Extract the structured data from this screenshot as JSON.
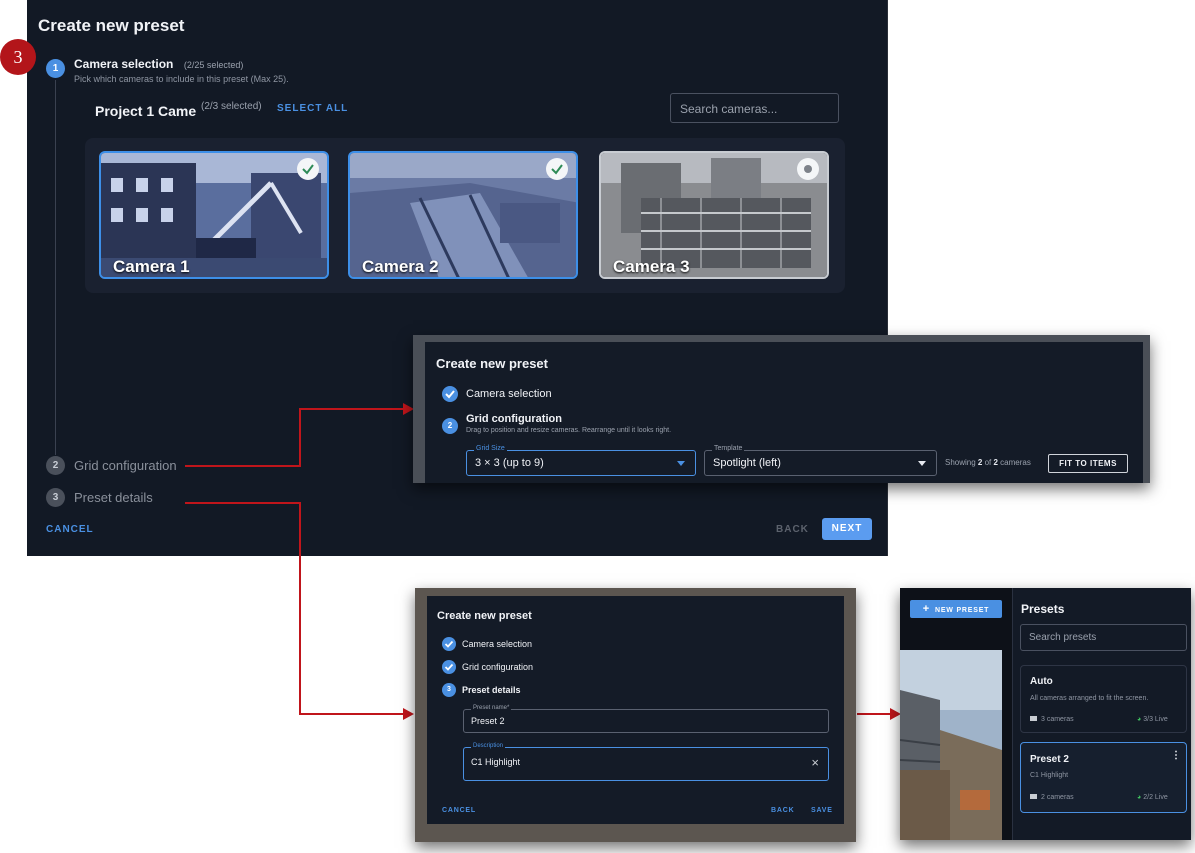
{
  "callout_number": "3",
  "main": {
    "title": "Create new preset",
    "steps": [
      {
        "number": "1",
        "title": "Camera selection",
        "count": "(2/25 selected)",
        "subtitle": "Pick which cameras to include in this preset (Max 25)."
      },
      {
        "number": "2",
        "title": "Grid configuration"
      },
      {
        "number": "3",
        "title": "Preset details"
      }
    ],
    "project": {
      "name": "Project 1 Came",
      "count": "(2/3 selected)",
      "select_all": "SELECT ALL"
    },
    "search_placeholder": "Search cameras...",
    "cameras": [
      {
        "label": "Camera 1",
        "selected": true
      },
      {
        "label": "Camera 2",
        "selected": true
      },
      {
        "label": "Camera 3",
        "selected": false
      }
    ],
    "cancel": "CANCEL",
    "back": "BACK",
    "next": "NEXT"
  },
  "inset_grid": {
    "title": "Create new preset",
    "step1": "Camera selection",
    "step2_number": "2",
    "step2": "Grid configuration",
    "step2_sub": "Drag to position and resize cameras. Rearrange until it looks right.",
    "grid_size_label": "Grid Size",
    "grid_size_value": "3 × 3 (up to 9)",
    "template_label": "Template",
    "template_value": "Spotlight (left)",
    "showing_prefix": "Showing ",
    "showing_a": "2",
    "showing_of": " of ",
    "showing_b": "2",
    "showing_suffix": " cameras",
    "fit_button": "FIT TO ITEMS"
  },
  "inset_details": {
    "title": "Create new preset",
    "step1": "Camera selection",
    "step2": "Grid configuration",
    "step3_number": "3",
    "step3": "Preset details",
    "name_label": "Preset name*",
    "name_value": "Preset 2",
    "desc_label": "Description",
    "desc_value": "C1 Highlight",
    "cancel": "CANCEL",
    "back": "BACK",
    "save": "SAVE"
  },
  "inset_presets": {
    "new_preset": "NEW PRESET",
    "heading": "Presets",
    "search_placeholder": "Search presets",
    "presets": [
      {
        "name": "Auto",
        "description": "All cameras arranged to fit the screen.",
        "cameras": "3 cameras",
        "live": "3/3 Live"
      },
      {
        "name": "Preset 2",
        "description": "C1 Highlight",
        "cameras": "2 cameras",
        "live": "2/2 Live"
      }
    ]
  },
  "colors": {
    "accent": "#4a90e2",
    "arrow": "#c0151b",
    "live": "#3fbf5f",
    "background": "#121925"
  }
}
